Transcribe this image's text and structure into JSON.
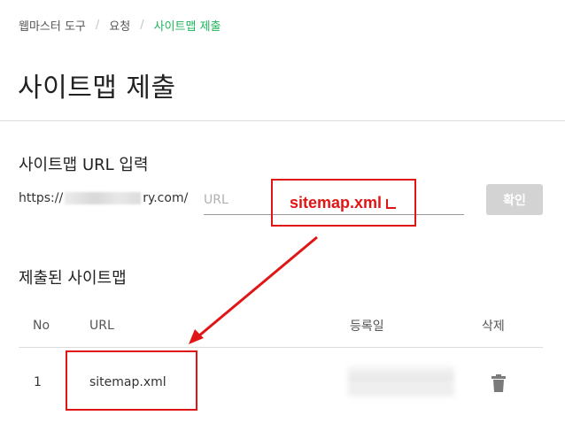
{
  "breadcrumb": {
    "items": [
      "웹마스터 도구",
      "요청"
    ],
    "current": "사이트맵 제출"
  },
  "page_title": "사이트맵 제출",
  "input_section": {
    "title": "사이트맵 URL 입력",
    "domain_prefix": "https://",
    "domain_suffix": "ry.com/",
    "url_placeholder": "URL",
    "confirm_label": "확인"
  },
  "annotation": {
    "input_callout_text": "sitemap.xml",
    "accent_color": "#e01616"
  },
  "submitted_section": {
    "title": "제출된 사이트맵",
    "columns": [
      "No",
      "URL",
      "등록일",
      "삭제"
    ],
    "rows": [
      {
        "no": "1",
        "url": "sitemap.xml"
      }
    ]
  },
  "colors": {
    "brand_green": "#1eb45b",
    "button_disabled": "#d3d3d3"
  }
}
